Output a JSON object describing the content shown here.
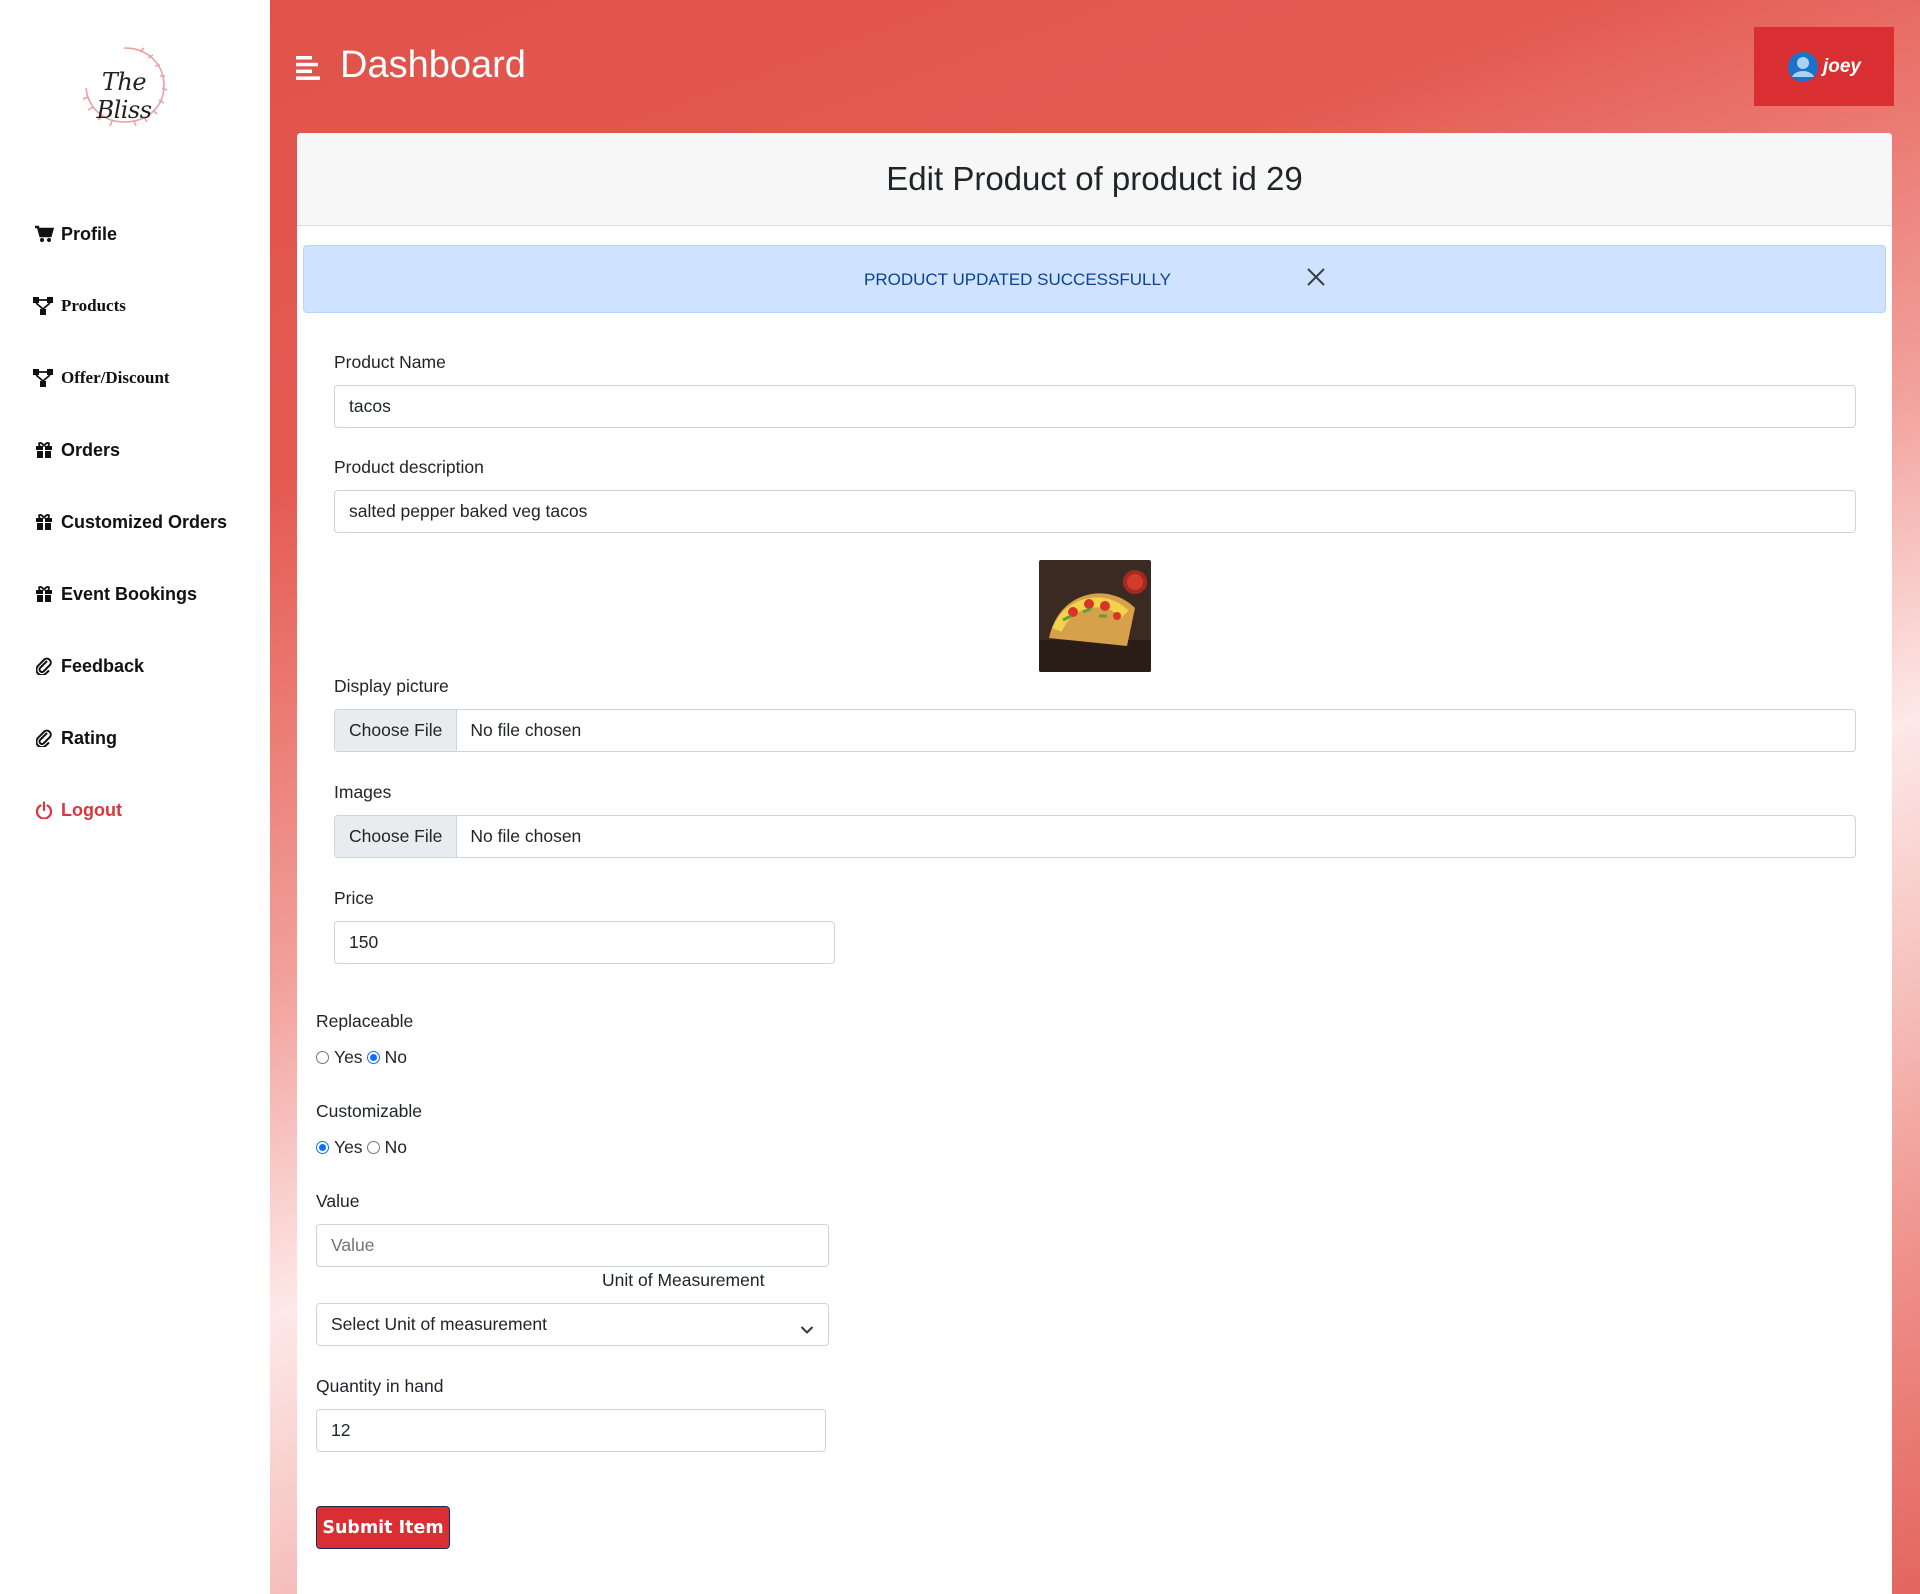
{
  "brand": {
    "logo_text": "The Bliss"
  },
  "sidebar": {
    "items": [
      {
        "label": "Profile",
        "icon": "cart-icon"
      },
      {
        "label": "Products",
        "icon": "hierarchy-icon"
      },
      {
        "label": "Offer/Discount",
        "icon": "hierarchy-icon"
      },
      {
        "label": "Orders",
        "icon": "gift-icon"
      },
      {
        "label": "Customized Orders",
        "icon": "gift-icon"
      },
      {
        "label": "Event Bookings",
        "icon": "gift-icon"
      },
      {
        "label": "Feedback",
        "icon": "paperclip-icon"
      },
      {
        "label": "Rating",
        "icon": "paperclip-icon"
      },
      {
        "label": "Logout",
        "icon": "power-icon"
      }
    ]
  },
  "header": {
    "title": "Dashboard",
    "user_name": "joey"
  },
  "card": {
    "title": "Edit Product of product id 29"
  },
  "alert": {
    "message": "PRODUCT UPDATED SUCCESSFULLY"
  },
  "form": {
    "product_name": {
      "label": "Product Name",
      "value": "tacos"
    },
    "description": {
      "label": "Product description",
      "value": "salted pepper baked veg tacos"
    },
    "display_picture": {
      "label": "Display picture",
      "button": "Choose File",
      "status": "No file chosen"
    },
    "images": {
      "label": "Images",
      "button": "Choose File",
      "status": "No file chosen"
    },
    "price": {
      "label": "Price",
      "value": "150"
    },
    "replaceable": {
      "label": "Replaceable",
      "yes": "Yes",
      "no": "No",
      "selected": "No"
    },
    "customizable": {
      "label": "Customizable",
      "yes": "Yes",
      "no": "No",
      "selected": "Yes"
    },
    "value": {
      "label": "Value",
      "placeholder": "Value"
    },
    "unit": {
      "label": "Unit of Measurement",
      "selected": "Select Unit of measurement"
    },
    "quantity": {
      "label": "Quantity in hand",
      "value": "12"
    },
    "submit_label": "Submit Item"
  },
  "colors": {
    "accent": "#d92f33",
    "alert_bg": "#cfe2ff",
    "alert_text": "#084298",
    "radio_checked": "#0d6efd"
  }
}
